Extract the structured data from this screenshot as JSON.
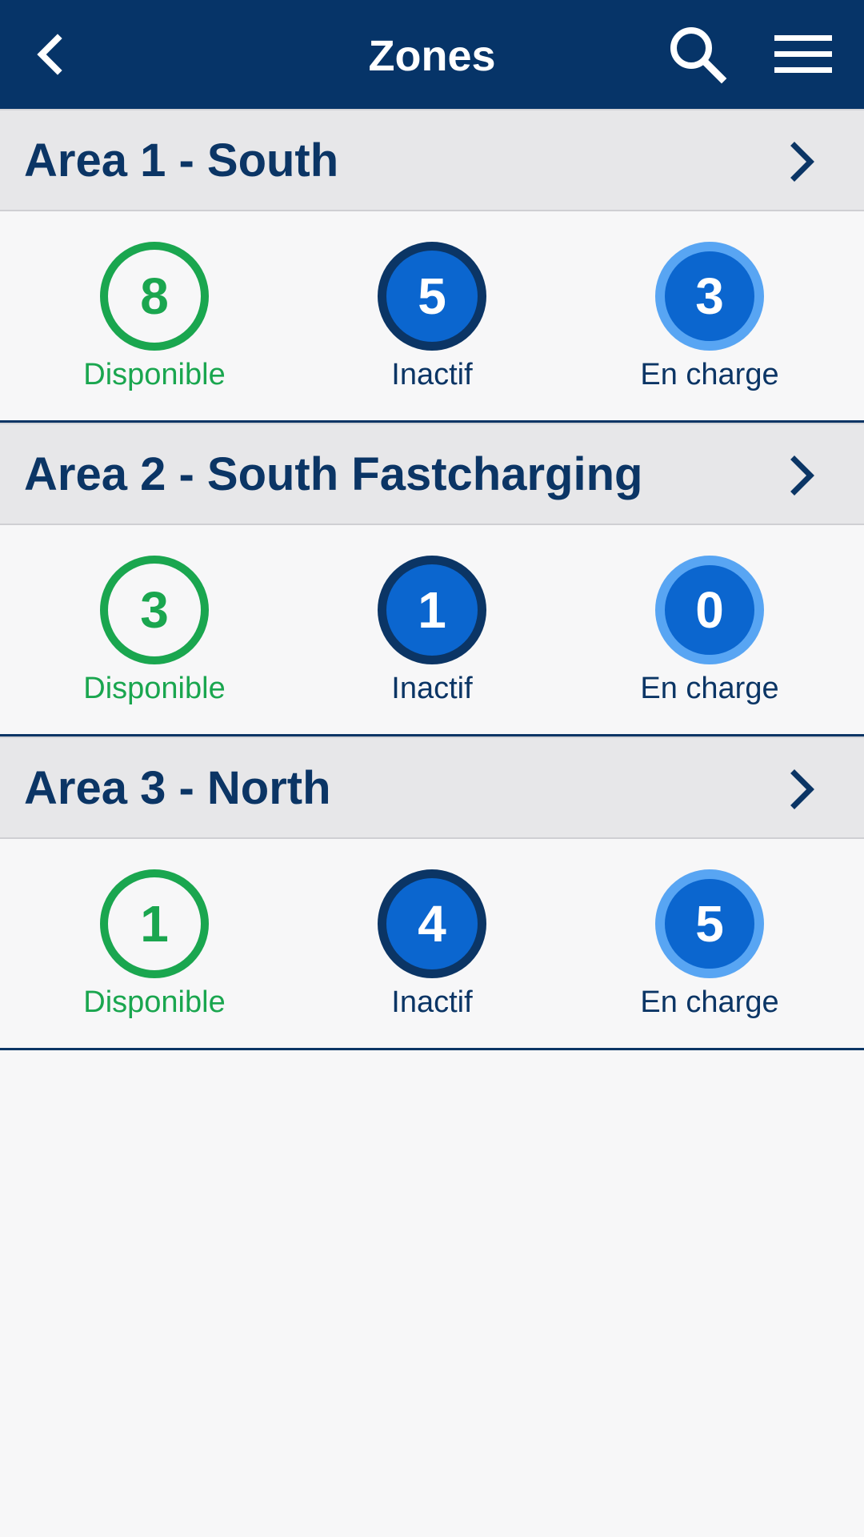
{
  "header": {
    "title": "Zones",
    "back_icon": "chevron-left-icon",
    "search_icon": "search-icon",
    "menu_icon": "hamburger-menu-icon"
  },
  "colors": {
    "header_bg": "#063468",
    "available": "#1aa64f",
    "inactive_ring": "#0b3565",
    "charging_ring": "#58a5f3",
    "circle_fill": "#0b66cf"
  },
  "zones": [
    {
      "name": "Area 1 - South",
      "available": {
        "count": "8",
        "label": "Disponible"
      },
      "inactive": {
        "count": "5",
        "label": "Inactif"
      },
      "charging": {
        "count": "3",
        "label": "En charge"
      }
    },
    {
      "name": "Area 2 - South Fastcharging",
      "available": {
        "count": "3",
        "label": "Disponible"
      },
      "inactive": {
        "count": "1",
        "label": "Inactif"
      },
      "charging": {
        "count": "0",
        "label": "En charge"
      }
    },
    {
      "name": "Area 3 - North",
      "available": {
        "count": "1",
        "label": "Disponible"
      },
      "inactive": {
        "count": "4",
        "label": "Inactif"
      },
      "charging": {
        "count": "5",
        "label": "En charge"
      }
    }
  ]
}
